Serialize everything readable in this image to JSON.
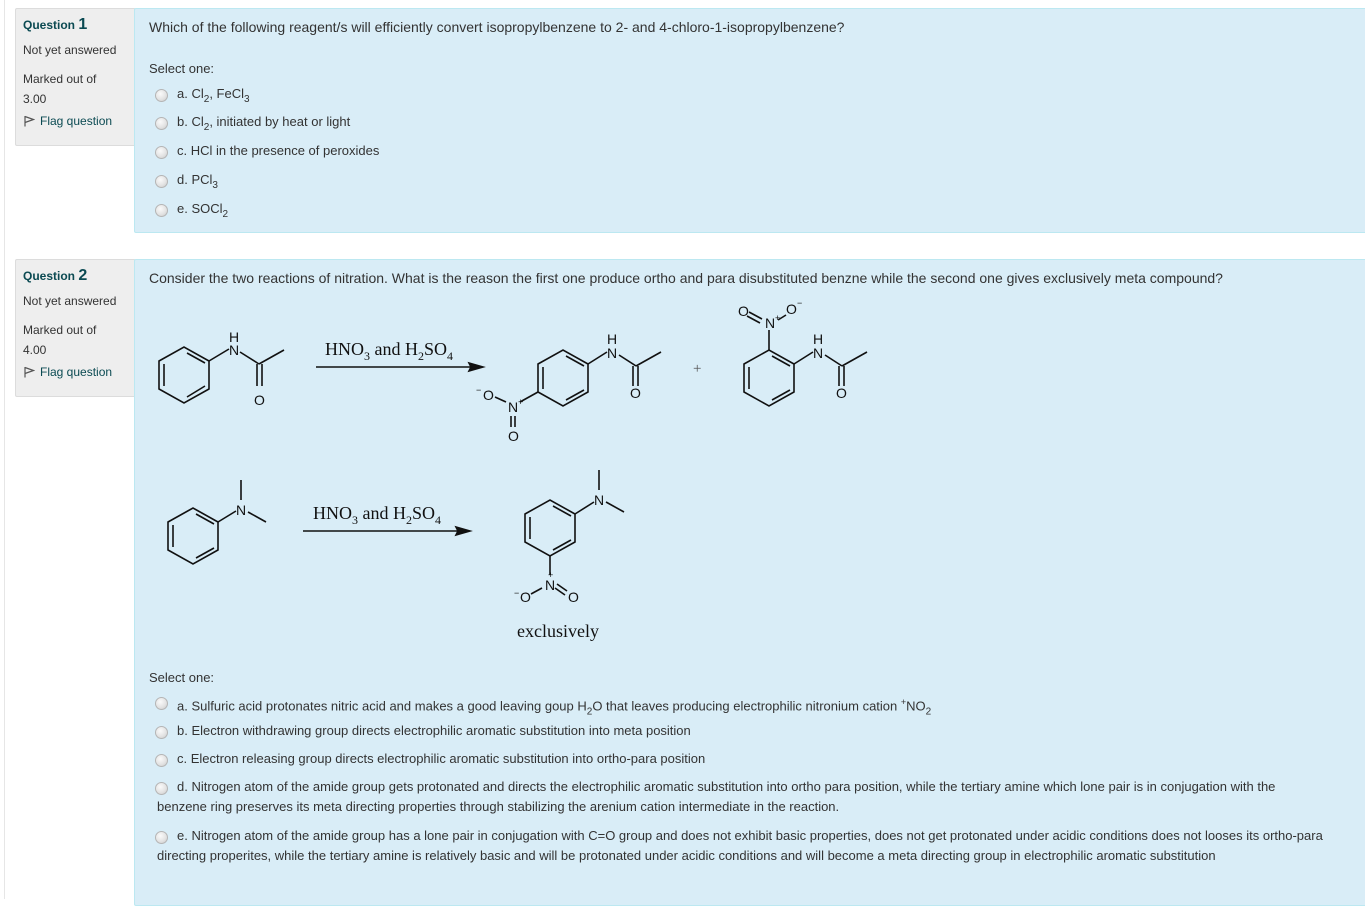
{
  "questions": [
    {
      "label": "Question",
      "number": "1",
      "state": "Not yet answered",
      "grade_label": "Marked out of",
      "grade_value": "3.00",
      "flag_label": "Flag question",
      "text": "Which of the following reagent/s will efficiently convert isopropylbenzene to 2- and 4-chloro-1-isopropylbenzene?",
      "prompt": "Select one:",
      "options": [
        {
          "letter": "a.",
          "parts": [
            "Cl",
            "2",
            ", FeCl",
            "3",
            ""
          ]
        },
        {
          "letter": "b.",
          "parts": [
            "Cl",
            "2",
            ", initiated by heat or light"
          ]
        },
        {
          "letter": "c.",
          "parts": [
            "HCl in the presence of peroxides"
          ]
        },
        {
          "letter": "d.",
          "parts": [
            "PCl",
            "3"
          ]
        },
        {
          "letter": "e.",
          "parts": [
            "SOCl",
            "2"
          ]
        }
      ]
    },
    {
      "label": "Question",
      "number": "2",
      "state": "Not yet answered",
      "grade_label": "Marked out of",
      "grade_value": "4.00",
      "flag_label": "Flag question",
      "text": "Consider the two reactions of nitration. What is the reason the first one produce ortho and para disubstituted benzne while the second one gives exclusively meta compound?",
      "scheme": {
        "reaction1": {
          "reagent_main": "HNO",
          "reagent_sub1": "3",
          "reagent_and": " and H",
          "reagent_sub2": "2",
          "reagent_so": "SO",
          "reagent_sub3": "4",
          "plus": "+",
          "atoms": {
            "N": "N",
            "H": "H",
            "O": "O",
            "Nplus": "N",
            "plus": "+",
            "minus": "−"
          }
        },
        "reaction2": {
          "reagent_main": "HNO",
          "reagent_sub1": "3",
          "reagent_and": " and H",
          "reagent_sub2": "2",
          "reagent_so": "SO",
          "reagent_sub3": "4",
          "note": "exclusively"
        }
      },
      "prompt": "Select one:",
      "options": [
        {
          "letter": "a.",
          "text_pre": "Sulfuric acid protonates nitric acid and makes a good leaving goup H",
          "sub1": "2",
          "text_mid": "O that leaves producing electrophilic nitronium cation ",
          "sup": "+",
          "text_no": "NO",
          "sub2": "2"
        },
        {
          "letter": "b.",
          "text": "Electron withdrawing group directs electrophilic aromatic substitution into meta position"
        },
        {
          "letter": "c.",
          "text": "Electron releasing group directs electrophilic aromatic substitution into ortho-para position"
        },
        {
          "letter": "d.",
          "text": "Nitrogen atom of the amide group gets protonated and directs the electrophilic aromatic substitution into ortho para position, while the tertiary amine which lone pair is in conjugation with the benzene ring preserves its meta directing properties through stabilizing the arenium cation intermediate in the reaction."
        },
        {
          "letter": "e.",
          "text": "Nitrogen atom of the amide group has a lone pair in conjugation with C=O group and does not exhibit basic properties, does not get protonated under acidic conditions does not looses its ortho-para directing properites, while the tertiary amine is relatively basic and will be protonated under acidic conditions and will become a meta directing group in electrophilic aromatic substitution"
        }
      ]
    }
  ],
  "colors": {
    "content_bg": "#d9edf7",
    "info_bg": "#eeeeee",
    "qno_color": "#0b4a52"
  }
}
